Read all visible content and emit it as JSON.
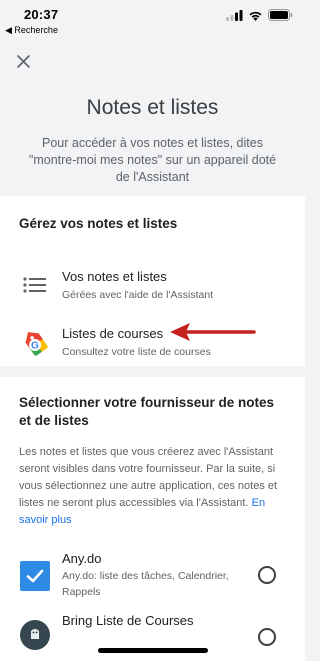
{
  "status_bar": {
    "time": "20:37",
    "back_label": "◀ Recherche",
    "icons": [
      "signal-icon",
      "wifi-icon",
      "battery-icon"
    ]
  },
  "header": {
    "close_icon": "close-icon",
    "title": "Notes et listes",
    "subtitle": "Pour accéder à vos notes et listes, dites \"montre-moi mes notes\" sur un appareil doté de l'Assistant"
  },
  "manage": {
    "title": "Gérez vos notes et listes",
    "items": [
      {
        "icon": "list-icon",
        "title": "Vos notes et listes",
        "subtitle": "Gérées avec l'aide de l'Assistant"
      },
      {
        "icon": "shopping-tag-icon",
        "title": "Listes de courses",
        "subtitle": "Consultez votre liste de courses"
      }
    ]
  },
  "provider": {
    "title": "Sélectionner votre fournisseur de notes et de listes",
    "description": "Les notes et listes que vous créerez avec l'Assistant seront visibles dans votre fournisseur. Par la suite, si vous sélectionnez une autre application, ces notes et listes ne seront plus accessibles via l'Assistant.",
    "learn_more": "En savoir plus",
    "options": [
      {
        "icon": "anydo-icon",
        "name": "Any.do",
        "description": "Any.do: liste des tâches, Calendrier, Rappels",
        "selected": false
      },
      {
        "icon": "bring-icon",
        "name": "Bring Liste de Courses",
        "description": "",
        "selected": false
      }
    ]
  },
  "colors": {
    "background": "#f1f3f4",
    "card": "#ffffff",
    "link": "#1a73e8",
    "arrow": "#c5221f",
    "anydo": "#2f8ae6"
  }
}
